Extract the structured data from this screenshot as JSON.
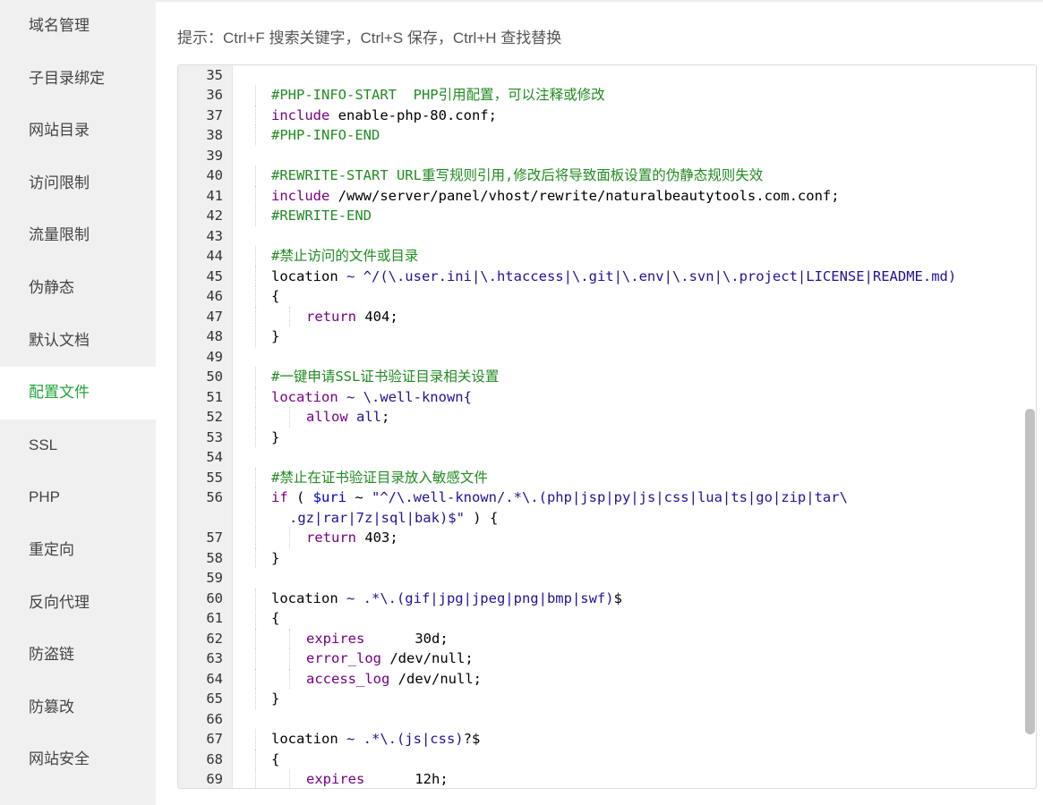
{
  "sidebar": {
    "items": [
      {
        "label": "域名管理",
        "active": false
      },
      {
        "label": "子目录绑定",
        "active": false
      },
      {
        "label": "网站目录",
        "active": false
      },
      {
        "label": "访问限制",
        "active": false
      },
      {
        "label": "流量限制",
        "active": false
      },
      {
        "label": "伪静态",
        "active": false
      },
      {
        "label": "默认文档",
        "active": false
      },
      {
        "label": "配置文件",
        "active": true
      },
      {
        "label": "SSL",
        "active": false
      },
      {
        "label": "PHP",
        "active": false
      },
      {
        "label": "重定向",
        "active": false
      },
      {
        "label": "反向代理",
        "active": false
      },
      {
        "label": "防盗链",
        "active": false
      },
      {
        "label": "防篡改",
        "active": false
      },
      {
        "label": "网站安全",
        "active": false
      }
    ]
  },
  "hint": "提示：Ctrl+F 搜索关键字，Ctrl+S 保存，Ctrl+H 查找替换",
  "colors": {
    "accent": "#20a53a",
    "sidebar_bg": "#f0f0f0",
    "keyword": "#770088",
    "comment": "#228b22",
    "variable": "#0000cc",
    "string": "#aa1111"
  },
  "editor": {
    "lines": [
      {
        "n": "35",
        "indent": 0,
        "segs": []
      },
      {
        "n": "36",
        "indent": 1,
        "segs": [
          {
            "t": "#PHP-INFO-START  PHP引用配置，可以注释或修改",
            "c": "cm"
          }
        ]
      },
      {
        "n": "37",
        "indent": 1,
        "segs": [
          {
            "t": "include",
            "c": "kw"
          },
          {
            "t": " enable-php-80.conf;",
            "c": ""
          }
        ]
      },
      {
        "n": "38",
        "indent": 1,
        "segs": [
          {
            "t": "#PHP-INFO-END",
            "c": "cm"
          }
        ]
      },
      {
        "n": "39",
        "indent": 0,
        "segs": []
      },
      {
        "n": "40",
        "indent": 1,
        "segs": [
          {
            "t": "#REWRITE-START URL重写规则引用,修改后将导致面板设置的伪静态规则失效",
            "c": "cm"
          }
        ]
      },
      {
        "n": "41",
        "indent": 1,
        "segs": [
          {
            "t": "include",
            "c": "kw"
          },
          {
            "t": " /www/server/panel/vhost/rewrite/naturalbeautytools.com.conf;",
            "c": ""
          }
        ]
      },
      {
        "n": "42",
        "indent": 1,
        "segs": [
          {
            "t": "#REWRITE-END",
            "c": "cm"
          }
        ]
      },
      {
        "n": "43",
        "indent": 0,
        "segs": []
      },
      {
        "n": "44",
        "indent": 1,
        "segs": [
          {
            "t": "#禁止访问的文件或目录",
            "c": "cm"
          }
        ]
      },
      {
        "n": "45",
        "indent": 1,
        "segs": [
          {
            "t": "location",
            "c": ""
          },
          {
            "t": " ~ ^/(\\.user.ini|\\.htaccess|\\.git|\\.env|\\.svn|\\.project|LICENSE|README.md)",
            "c": "at"
          }
        ]
      },
      {
        "n": "46",
        "indent": 1,
        "segs": [
          {
            "t": "{",
            "c": ""
          }
        ]
      },
      {
        "n": "47",
        "indent": 2,
        "segs": [
          {
            "t": "return",
            "c": "kw"
          },
          {
            "t": " 404;",
            "c": ""
          }
        ]
      },
      {
        "n": "48",
        "indent": 1,
        "segs": [
          {
            "t": "}",
            "c": ""
          }
        ]
      },
      {
        "n": "49",
        "indent": 0,
        "segs": []
      },
      {
        "n": "50",
        "indent": 1,
        "segs": [
          {
            "t": "#一键申请SSL证书验证目录相关设置",
            "c": "cm"
          }
        ]
      },
      {
        "n": "51",
        "indent": 1,
        "segs": [
          {
            "t": "location",
            "c": "kw"
          },
          {
            "t": " ~ \\.well-known{",
            "c": "at"
          }
        ]
      },
      {
        "n": "52",
        "indent": 2,
        "segs": [
          {
            "t": "allow",
            "c": "kw"
          },
          {
            "t": " all",
            "c": "at"
          },
          {
            "t": ";",
            "c": ""
          }
        ]
      },
      {
        "n": "53",
        "indent": 1,
        "segs": [
          {
            "t": "}",
            "c": ""
          }
        ]
      },
      {
        "n": "54",
        "indent": 0,
        "segs": []
      },
      {
        "n": "55",
        "indent": 1,
        "segs": [
          {
            "t": "#禁止在证书验证目录放入敏感文件",
            "c": "cm"
          }
        ]
      },
      {
        "n": "56",
        "indent": 1,
        "wrap": true,
        "segs": [
          {
            "t": "if",
            "c": "kw"
          },
          {
            "t": " ( ",
            "c": ""
          },
          {
            "t": "$uri",
            "c": "vr"
          },
          {
            "t": " ~ ",
            "c": ""
          },
          {
            "t": "\"^/\\.well-known/.*\\.(php|jsp|py|js|css|lua|ts|go|zip|tar\\",
            "c": "at"
          }
        ],
        "cont": [
          {
            "t": ".gz|rar|7z|sql|bak)$\"",
            "c": "at"
          },
          {
            "t": " ) {",
            "c": ""
          }
        ]
      },
      {
        "n": "57",
        "indent": 2,
        "segs": [
          {
            "t": "return",
            "c": "kw"
          },
          {
            "t": " 403;",
            "c": ""
          }
        ]
      },
      {
        "n": "58",
        "indent": 1,
        "segs": [
          {
            "t": "}",
            "c": ""
          }
        ]
      },
      {
        "n": "59",
        "indent": 0,
        "segs": []
      },
      {
        "n": "60",
        "indent": 1,
        "segs": [
          {
            "t": "location",
            "c": ""
          },
          {
            "t": " ~ .*\\.(gif|jpg|jpeg|png|bmp|swf)",
            "c": "at"
          },
          {
            "t": "$",
            "c": ""
          }
        ]
      },
      {
        "n": "61",
        "indent": 1,
        "segs": [
          {
            "t": "{",
            "c": ""
          }
        ]
      },
      {
        "n": "62",
        "indent": 2,
        "segs": [
          {
            "t": "expires",
            "c": "kw"
          },
          {
            "t": "      30d;",
            "c": ""
          }
        ]
      },
      {
        "n": "63",
        "indent": 2,
        "segs": [
          {
            "t": "error_log",
            "c": "kw"
          },
          {
            "t": " /dev/null;",
            "c": ""
          }
        ]
      },
      {
        "n": "64",
        "indent": 2,
        "segs": [
          {
            "t": "access_log",
            "c": "kw"
          },
          {
            "t": " /dev/null;",
            "c": ""
          }
        ]
      },
      {
        "n": "65",
        "indent": 1,
        "segs": [
          {
            "t": "}",
            "c": ""
          }
        ]
      },
      {
        "n": "66",
        "indent": 0,
        "segs": []
      },
      {
        "n": "67",
        "indent": 1,
        "segs": [
          {
            "t": "location",
            "c": ""
          },
          {
            "t": " ~ .*\\.(js|css)",
            "c": "at"
          },
          {
            "t": "?$",
            "c": ""
          }
        ]
      },
      {
        "n": "68",
        "indent": 1,
        "segs": [
          {
            "t": "{",
            "c": ""
          }
        ]
      },
      {
        "n": "69",
        "indent": 2,
        "segs": [
          {
            "t": "expires",
            "c": "kw"
          },
          {
            "t": "      12h;",
            "c": ""
          }
        ]
      }
    ]
  }
}
